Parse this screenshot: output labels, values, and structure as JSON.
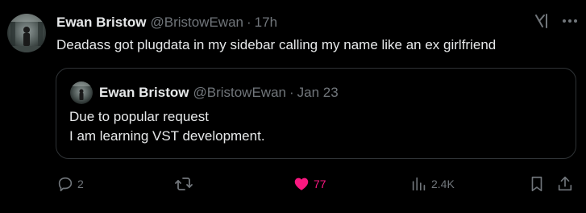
{
  "post": {
    "author": {
      "name": "Ewan Bristow",
      "handle": "@BristowEwan",
      "separator": "·",
      "timestamp": "17h"
    },
    "text": "Deadass got plugdata in my sidebar calling my name like an ex girlfriend",
    "quoted": {
      "author": {
        "name": "Ewan Bristow",
        "handle": "@BristowEwan",
        "separator": "·",
        "timestamp": "Jan 23"
      },
      "lines": [
        "Due to popular request",
        "I am learning VST development."
      ]
    },
    "actions": {
      "reply": {
        "icon": "reply-icon",
        "count": "2"
      },
      "repost": {
        "icon": "repost-icon",
        "count": ""
      },
      "like": {
        "icon": "heart-filled-icon",
        "count": "77",
        "liked": true
      },
      "views": {
        "icon": "views-icon",
        "count": "2.4K"
      },
      "bookmark": {
        "icon": "bookmark-icon"
      },
      "share": {
        "icon": "share-icon"
      }
    },
    "header_icons": [
      "grok-icon",
      "more-icon"
    ]
  },
  "colors": {
    "background": "#000000",
    "text_primary": "#e7e9ea",
    "text_secondary": "#71767b",
    "border": "#2f3336",
    "like_pink": "#f91880"
  }
}
